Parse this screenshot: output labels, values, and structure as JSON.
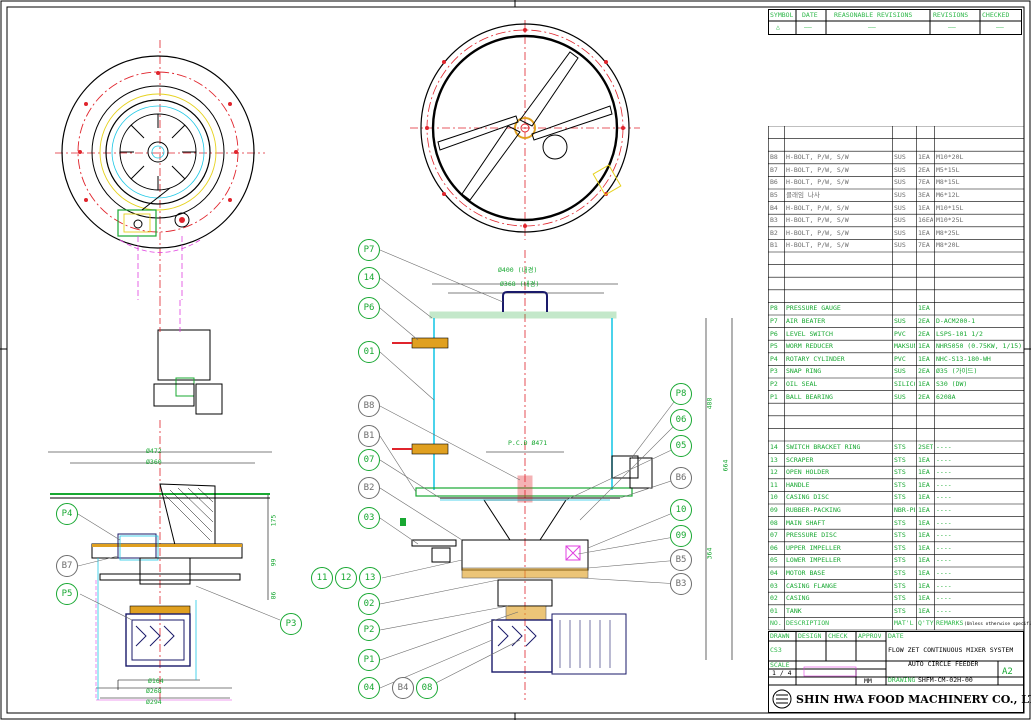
{
  "revision_table": {
    "headers": [
      "SYMBOL",
      "DATE",
      "REASONABLE REVISIONS",
      "REVISIONS",
      "CHECKED"
    ],
    "row": [
      "△",
      "——",
      "——",
      "——",
      "——"
    ]
  },
  "bom_bolts": [
    [
      "B8",
      "H-BOLT, P/W, S/W",
      "SUS",
      "1EA",
      "M10*20L"
    ],
    [
      "B7",
      "H-BOLT, P/W, S/W",
      "SUS",
      "2EA",
      "M5*15L"
    ],
    [
      "B6",
      "H-BOLT, P/W, S/W",
      "SUS",
      "7EA",
      "M8*15L"
    ],
    [
      "B5",
      "클래임 나사",
      "SUS",
      "3EA",
      "M6*12L"
    ],
    [
      "B4",
      "H-BOLT, P/W, S/W",
      "SUS",
      "1EA",
      "M10*15L"
    ],
    [
      "B3",
      "H-BOLT, P/W, S/W",
      "SUS",
      "16EA",
      "M10*25L"
    ],
    [
      "B2",
      "H-BOLT, P/W, S/W",
      "SUS",
      "1EA",
      "M8*25L"
    ],
    [
      "B1",
      "H-BOLT, P/W, S/W",
      "SUS",
      "7EA",
      "M8*20L"
    ]
  ],
  "bom_purchased": [
    [
      "P8",
      "PRESSURE GAUGE",
      "",
      "1EA",
      ""
    ],
    [
      "P7",
      "AIR BEATER",
      "SUS",
      "2EA",
      "D-ACM200-1"
    ],
    [
      "P6",
      "LEVEL SWITCH",
      "PVC",
      "2EA",
      "LSPS-101 1/2"
    ],
    [
      "P5",
      "WORM REDUCER",
      "MAKSUN",
      "1EA",
      "NHR5050 (0.75KW, 1/15)"
    ],
    [
      "P4",
      "ROTARY CYLINDER",
      "PVC",
      "1EA",
      "NHC-S13-180-WH"
    ],
    [
      "P3",
      "SNAP RING",
      "SUS",
      "2EA",
      "Ø35 (가이드)"
    ],
    [
      "P2",
      "OIL SEAL",
      "SILICONE",
      "1EA",
      "S30 (DW)"
    ],
    [
      "P1",
      "BALL BEARING",
      "SUS",
      "2EA",
      "6208A"
    ]
  ],
  "bom_parts": [
    [
      "14",
      "SWITCH BRACKET RING",
      "STS",
      "2SET",
      "----"
    ],
    [
      "13",
      "SCRAPER",
      "STS",
      "1EA",
      "----"
    ],
    [
      "12",
      "OPEN HOLDER",
      "STS",
      "1EA",
      "----"
    ],
    [
      "11",
      "HANDLE",
      "STS",
      "1EA",
      "----"
    ],
    [
      "10",
      "CASING DISC",
      "STS",
      "1EA",
      "----"
    ],
    [
      "09",
      "RUBBER-PACKING",
      "NBR-PE",
      "1EA",
      "----"
    ],
    [
      "08",
      "MAIN SHAFT",
      "STS",
      "1EA",
      "----"
    ],
    [
      "07",
      "PRESSURE DISC",
      "STS",
      "1EA",
      "----"
    ],
    [
      "06",
      "UPPER IMPELLER",
      "STS",
      "1EA",
      "----"
    ],
    [
      "05",
      "LOWER IMPELLER",
      "STS",
      "1EA",
      "----"
    ],
    [
      "04",
      "MOTOR BASE",
      "STS",
      "1EA",
      "----"
    ],
    [
      "03",
      "CASING FLANGE",
      "STS",
      "1EA",
      "----"
    ],
    [
      "02",
      "CASING",
      "STS",
      "1EA",
      "----"
    ],
    [
      "01",
      "TANK",
      "STS",
      "1EA",
      "----"
    ]
  ],
  "bom_header": [
    "NO.",
    "DESCRIPTION",
    "MAT'L",
    "Q'TY",
    "REMARKS"
  ],
  "remarks_note": "(Unless otherwise specified)",
  "title_block": {
    "drawn": "DRAWN",
    "design": "DESIGN",
    "check": "CHECK",
    "approv": "APPROV",
    "date": "DATE",
    "scale_label": "SCALE",
    "scale_value": "1 / 4",
    "cs": "CS3",
    "unit": "MM",
    "drawing_no_label": "DRAWING",
    "drawing_no": "SHFM-CM-02H-00",
    "title1": "FLOW ZET CONTINUOUS MIXER SYSTEM",
    "title2": "AUTO CIRCLE FEEDER",
    "size": "A2",
    "company": "SHIN HWA FOOD MACHINERY CO., LTD."
  },
  "dimensions": {
    "top_dia_outer": "Ø400 (내경)",
    "top_dia_inner": "Ø368 (내경)",
    "pcd": "P.C.D Ø471",
    "height_upper": "488",
    "height_total": "664",
    "height_lower": "364",
    "left_dia_472": "Ø472",
    "left_dia_360": "Ø360",
    "left_dia_164": "Ø164",
    "left_dia_268": "Ø268",
    "left_dia_294": "Ø294",
    "left_h_175": "175",
    "left_h_99": "99",
    "left_h_86": "86"
  },
  "balloons": {
    "P7": "P7",
    "14": "14",
    "P6": "P6",
    "01": "01",
    "B8": "B8",
    "B1": "B1",
    "07": "07",
    "B2": "B2",
    "03": "03",
    "11": "11",
    "12": "12",
    "13": "13",
    "02": "02",
    "P2": "P2",
    "P1": "P1",
    "04": "04",
    "B4": "B4",
    "08": "08",
    "P8": "P8",
    "06": "06",
    "05": "05",
    "B6": "B6",
    "10": "10",
    "09": "09",
    "B5": "B5",
    "B3": "B3",
    "P4": "P4",
    "B7": "B7",
    "P5": "P5",
    "P3": "P3"
  },
  "colors": {
    "green": "#18a832",
    "red": "#e0242c",
    "magenta": "#e040e0",
    "cyan": "#1ec8e6",
    "yellow": "#d8d800",
    "gray": "#6d6d6d",
    "navy": "#1a1a6a"
  }
}
